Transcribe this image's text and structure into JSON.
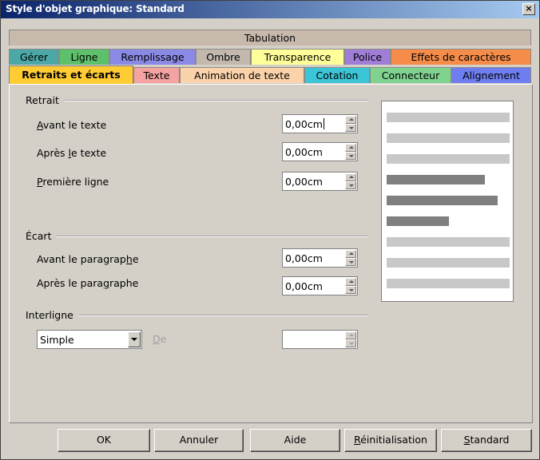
{
  "window": {
    "title": "Style d'objet graphique: Standard",
    "close_glyph": "×"
  },
  "tabs": {
    "row1": [
      {
        "label": "Tabulation",
        "color": "#c8b9ad"
      }
    ],
    "row2": [
      {
        "label": "Gérer",
        "color": "#4ca8a6"
      },
      {
        "label": "Ligne",
        "color": "#5dc06a"
      },
      {
        "label": "Remplissage",
        "color": "#8a8ae6"
      },
      {
        "label": "Ombre",
        "color": "#c2b8ae"
      },
      {
        "label": "Transparence",
        "color": "#ffff99"
      },
      {
        "label": "Police",
        "color": "#a07ed8"
      },
      {
        "label": "Effets de caractères",
        "color": "#f58c4a"
      }
    ],
    "row3": [
      {
        "label": "Retraits et écarts",
        "color": "#ffcc33",
        "active": true
      },
      {
        "label": "Texte",
        "color": "#f4a2a2"
      },
      {
        "label": "Animation de texte",
        "color": "#fbd3aa"
      },
      {
        "label": "Cotation",
        "color": "#3cc5d6"
      },
      {
        "label": "Connecteur",
        "color": "#7fd38f"
      },
      {
        "label": "Alignement",
        "color": "#6e7ef0"
      }
    ]
  },
  "retrait": {
    "heading": "Retrait",
    "fields": [
      {
        "label_pre": "",
        "label_u": "A",
        "label_post": "vant le texte",
        "value": "0,00cm",
        "focused": true
      },
      {
        "label_pre": "Après ",
        "label_u": "l",
        "label_post": "e texte",
        "value": "0,00cm"
      },
      {
        "label_pre": "",
        "label_u": "P",
        "label_post": "remière ligne",
        "value": "0,00cm"
      }
    ]
  },
  "ecart": {
    "heading": "Écart",
    "fields": [
      {
        "label_pre": "Avant le paragrap",
        "label_u": "h",
        "label_post": "e",
        "value": "0,00cm"
      },
      {
        "label_pre": "Après le para",
        "label_u": "g",
        "label_post": "raphe",
        "value": "0,00cm"
      }
    ]
  },
  "interligne": {
    "heading": "Interligne",
    "selected": "Simple",
    "de_label_u": "D",
    "de_label_post": "e",
    "de_value": ""
  },
  "preview_colors": {
    "light": "#c8c8c8",
    "dark": "#808080"
  },
  "buttons": {
    "ok": "OK",
    "annuler": "Annuler",
    "aide": "Aide",
    "reinit_u": "R",
    "reinit_post": "éinitialisation",
    "standard_u": "S",
    "standard_post": "tandard"
  }
}
